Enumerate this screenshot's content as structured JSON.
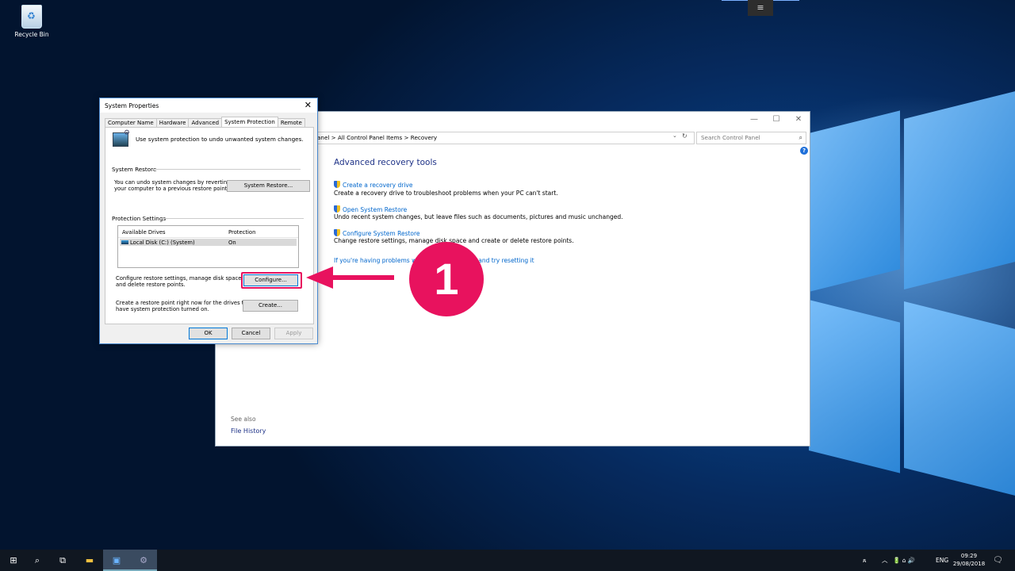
{
  "desktop": {
    "recycle_bin_label": "Recycle Bin",
    "top_menu_glyph": "≡"
  },
  "control_panel": {
    "window_controls": [
      "—",
      "☐",
      "✕"
    ],
    "address_path": "anel  >  All Control Panel Items  >  Recovery",
    "address_dropdown": "⌄",
    "refresh_glyph": "↻",
    "search_placeholder": "Search Control Panel",
    "search_icon": "search-icon",
    "help_glyph": "?",
    "heading": "Advanced recovery tools",
    "tools": [
      {
        "link": "Create a recovery drive",
        "desc": "Create a recovery drive to troubleshoot problems when your PC can't start."
      },
      {
        "link": "Open System Restore",
        "desc": "Undo recent system changes, but leave files such as documents, pictures and music unchanged."
      },
      {
        "link": "Configure System Restore",
        "desc": "Change restore settings, manage disk space and create or delete restore points."
      }
    ],
    "trouble_link_start": "If you're having problems wit",
    "trouble_link_end": "s and try resetting it",
    "see_also": "See also",
    "file_history": "File History"
  },
  "system_properties": {
    "title": "System Properties",
    "close_glyph": "✕",
    "tabs": [
      "Computer Name",
      "Hardware",
      "Advanced",
      "System Protection",
      "Remote"
    ],
    "active_tab": "System Protection",
    "intro": "Use system protection to undo unwanted system changes.",
    "system_restore_group": "System Restore",
    "system_restore_note_1": "You can undo system changes by reverting",
    "system_restore_note_2": "your computer to a previous restore point.",
    "system_restore_button": "System Restore...",
    "protection_group": "Protection Settings",
    "columns": [
      "Available Drives",
      "Protection"
    ],
    "drives": [
      {
        "name": "Local Disk (C:) (System)",
        "protection": "On"
      }
    ],
    "configure_note_1": "Configure restore settings, manage disk space,",
    "configure_note_2": "and delete restore points.",
    "configure_button": "Configure...",
    "create_note_1": "Create a restore point right now for the drives that",
    "create_note_2": "have system protection turned on.",
    "create_button": "Create...",
    "ok_button": "OK",
    "cancel_button": "Cancel",
    "apply_button": "Apply"
  },
  "annotation": {
    "step_number": "1",
    "color": "#e8125e"
  },
  "taskbar": {
    "icons": [
      "windows-start-icon",
      "search-icon",
      "task-view-icon",
      "file-explorer-icon",
      "control-panel-icon",
      "system-properties-icon"
    ],
    "start_glyph": "⊞",
    "search_glyph": "⌕",
    "taskview_glyph": "⧉",
    "explorer_glyph": "▬",
    "controlpanel_glyph": "▣",
    "sysprop_glyph": "⚙",
    "tray_people": "ጸ",
    "tray_chevron": "︿",
    "tray_icons": "🔋 ⌂ 🔊",
    "language": "ENG",
    "time": "09:29",
    "date": "29/08/2018",
    "notification_glyph": "🗨"
  }
}
